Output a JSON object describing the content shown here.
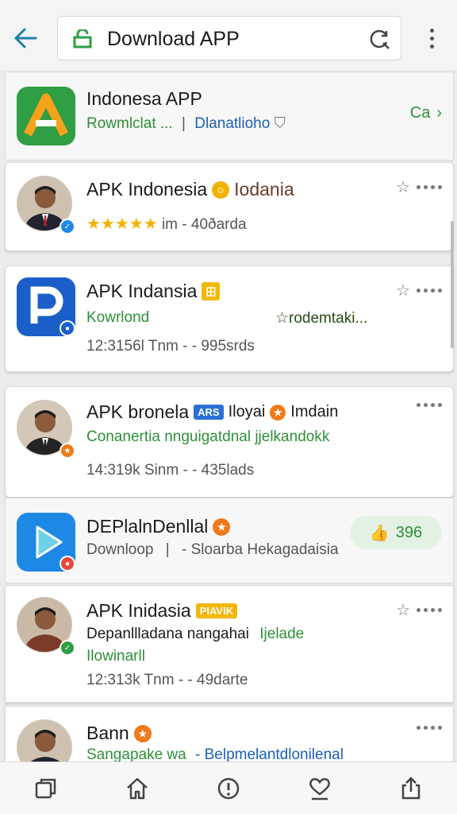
{
  "topbar": {
    "search_text": "Download APP"
  },
  "cards": [
    {
      "title": "Indonesa APP",
      "line1_a": "Rowmlclat ...",
      "line1_sep": "|",
      "line1_b": "Dlanatlioho",
      "right_label": "Ca"
    },
    {
      "title": "APK Indonesia",
      "title_extra": "Iodania",
      "stars": "★★★★★",
      "meta": "im  - 40ðarda"
    },
    {
      "title": "APK Indansia",
      "tag": "田",
      "line1_a": "Kowrlond",
      "line1_b": "☆rodemtaki...",
      "meta": "12:3156l  Tnm - - 995srds"
    },
    {
      "title": "APK bronela",
      "tag": "ARS",
      "title_extra_a": "Iloyai",
      "title_extra_b": "Imdain",
      "line1": "Conanertia nnguigatdnal  jjelkandokk",
      "meta": "14:319k  Sinm - - 435lads"
    },
    {
      "title": "DEPlalnDenllal",
      "line1_a": "Downloop",
      "line1_sep": "|",
      "line1_b": "- Sloarba Hekagadaisia",
      "pill": "396"
    },
    {
      "title": "APK Inidasia",
      "tag": "PIAVIK",
      "line1_a": "Depanllladana nangahai",
      "line1_b": "Ijelade",
      "line2": "Ilowinarll",
      "meta": "12:313k  Tnm - - 49darte"
    },
    {
      "title": "Bann",
      "line1_a": "Sangapake wa",
      "line1_b": "- Belpmelantdlonilenal"
    }
  ],
  "colors": {
    "green": "#2f8f3a",
    "blue": "#1b5fb8",
    "star": "#f0b400",
    "tag_blue": "#2a6fd6",
    "tag_yellow": "#f2b705",
    "accent": "#1e7fa8"
  },
  "icons": {
    "back": "arrow-left-icon",
    "lock": "lock-icon",
    "refresh": "refresh-search-icon",
    "menu": "kebab-menu-icon",
    "nav": [
      "tabs-icon",
      "home-icon",
      "info-icon",
      "heart-icon",
      "share-icon"
    ]
  }
}
